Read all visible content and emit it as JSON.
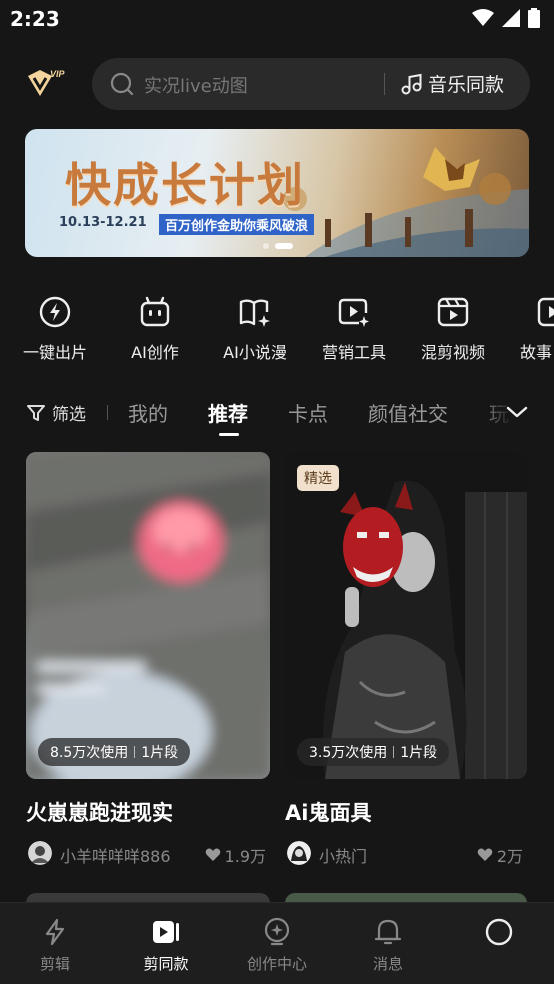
{
  "status_bar": {
    "time": "2:23"
  },
  "header": {
    "search_placeholder": "实况live动图",
    "music_label": "音乐同款"
  },
  "banner": {
    "title": "快成长计划",
    "date": "10.13-12.21",
    "slogan": "百万创作金助你乘风破浪",
    "slide_count": 2,
    "active_slide": 2
  },
  "tools": [
    {
      "label": "一键出片",
      "icon": "lightning-circle-icon"
    },
    {
      "label": "AI创作",
      "icon": "robot-icon"
    },
    {
      "label": "AI小说漫",
      "icon": "book-sparkle-icon"
    },
    {
      "label": "营销工具",
      "icon": "play-sparkle-icon"
    },
    {
      "label": "混剪视频",
      "icon": "film-play-icon"
    },
    {
      "label": "故事",
      "icon": "play-box-icon"
    }
  ],
  "tabs": {
    "filter_label": "筛选",
    "items": [
      {
        "label": "我的"
      },
      {
        "label": "推荐",
        "active": true
      },
      {
        "label": "卡点"
      },
      {
        "label": "颜值社交"
      },
      {
        "label": "玩"
      }
    ]
  },
  "cards": [
    {
      "title": "火崽崽跑进现实",
      "usage": "8.5万次使用",
      "segments": "1片段",
      "author": "小羊咩咩咩886",
      "likes": "1.9万",
      "badge": ""
    },
    {
      "title": "Ai鬼面具",
      "usage": "3.5万次使用",
      "segments": "1片段",
      "author": "小热门",
      "likes": "2万",
      "badge": "精选"
    }
  ],
  "bottom_nav": [
    {
      "label": "剪辑",
      "icon": "lightning-icon"
    },
    {
      "label": "剪同款",
      "icon": "template-play-icon",
      "active": true
    },
    {
      "label": "创作中心",
      "icon": "creator-bulb-icon"
    },
    {
      "label": "消息",
      "icon": "bell-icon"
    },
    {
      "label": "",
      "icon": "profile-circle-icon"
    }
  ],
  "colors": {
    "background": "#161616",
    "banner_title": "#c77a3c",
    "badge_bg": "#f1e1cc"
  }
}
